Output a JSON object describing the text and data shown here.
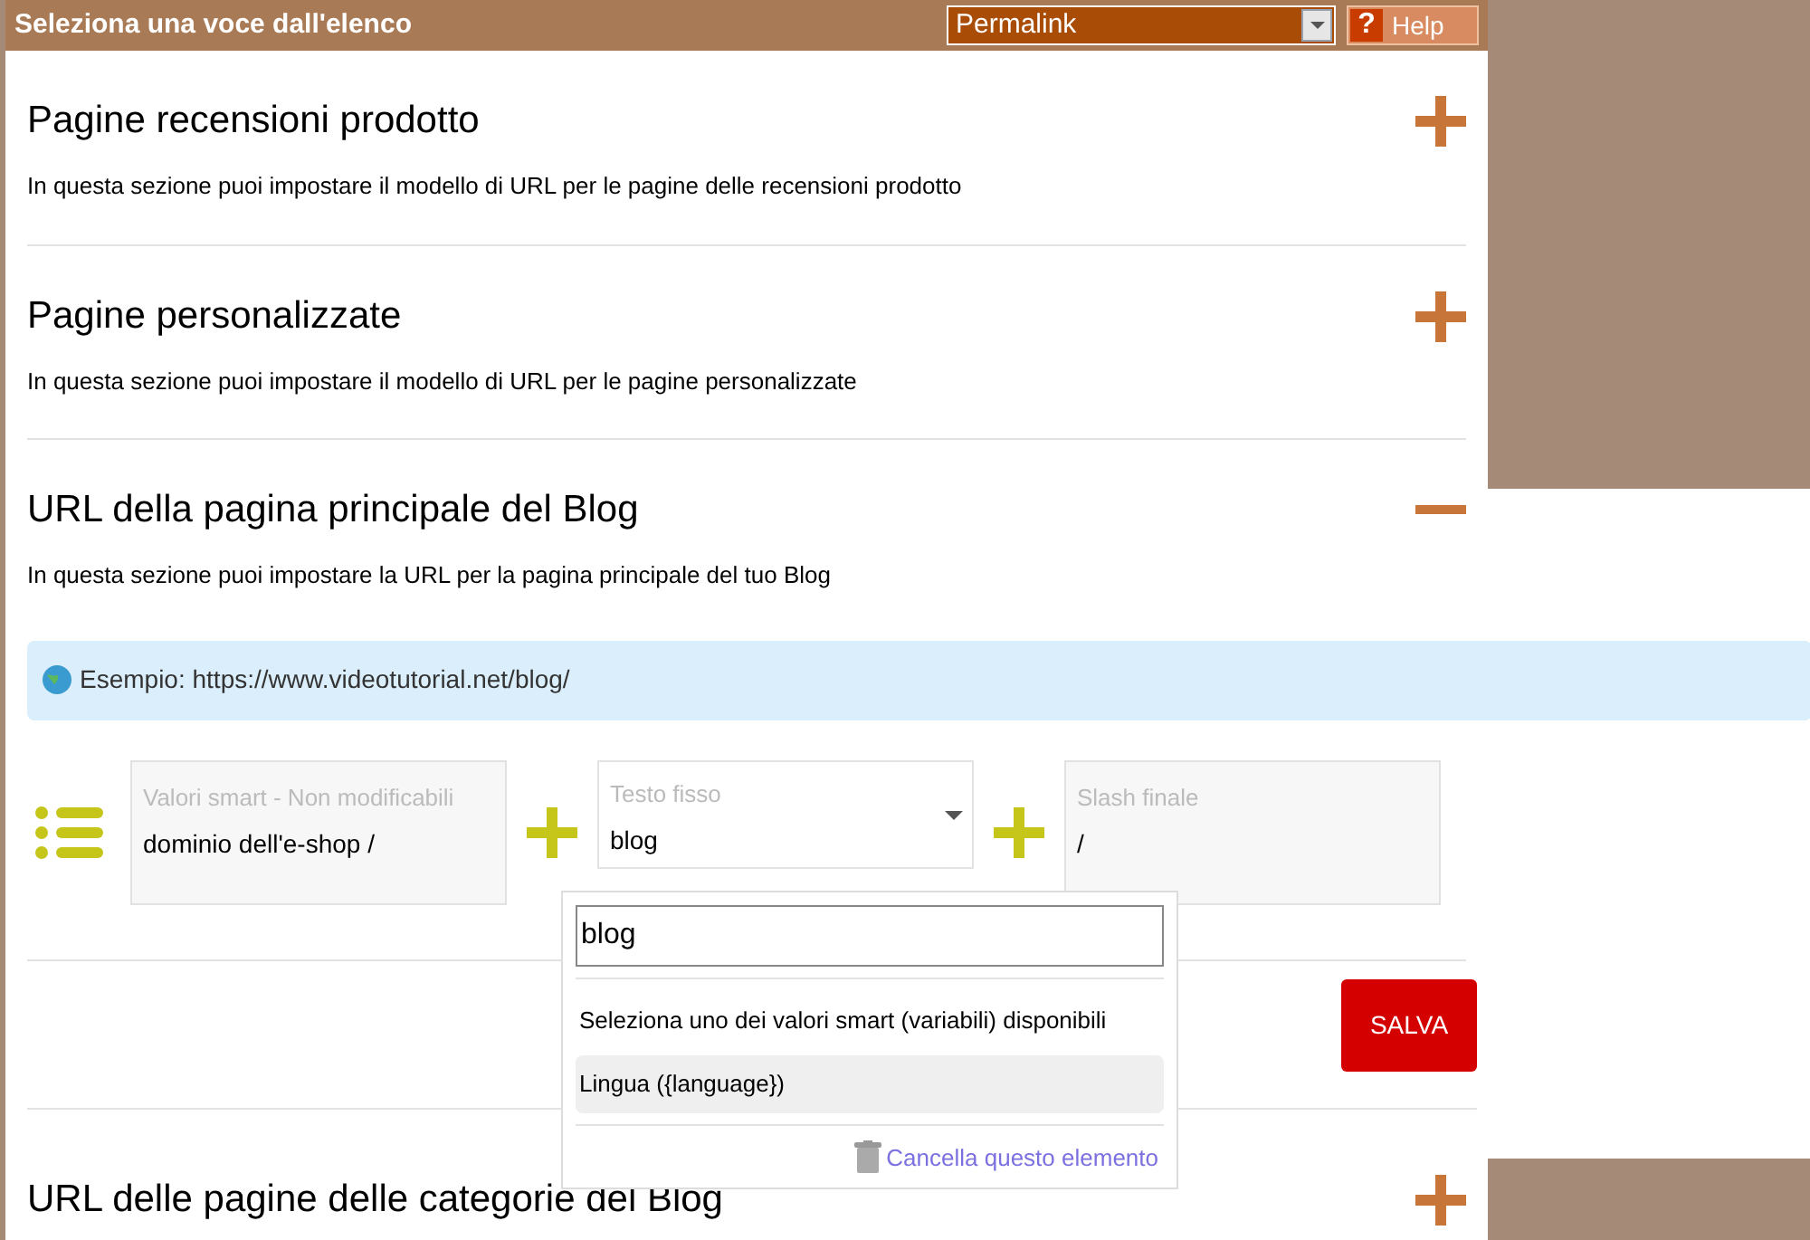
{
  "header": {
    "title": "Seleziona una voce dall'elenco",
    "select": {
      "value": "Permalink"
    },
    "help_button": {
      "label": "Help",
      "icon_text": "?"
    }
  },
  "sections": [
    {
      "title": "Pagine recensioni prodotto",
      "expanded": false,
      "description": "In questa sezione puoi impostare il modello di URL per le pagine delle recensioni prodotto"
    },
    {
      "title": "Pagine personalizzate",
      "expanded": false,
      "description": "In questa sezione puoi impostare il modello di URL per le pagine personalizzate"
    },
    {
      "title": "URL della pagina principale del Blog",
      "expanded": true,
      "description": "In questa sezione puoi impostare la URL per la pagina principale del tuo Blog",
      "example": "Esempio: https://www.videotutorial.net/blog/",
      "fields": [
        {
          "kind": "fixed",
          "label": "Valori smart - Non modificabili",
          "value": "dominio dell'e-shop /"
        },
        {
          "kind": "dropdown",
          "label": "Testo fisso",
          "value": "blog"
        },
        {
          "kind": "fixed",
          "label": "Slash finale",
          "value": "/"
        }
      ],
      "save_button": "SALVA",
      "popup": {
        "input_value": "blog",
        "hint": "Seleziona uno dei valori smart (variabili) disponibili",
        "options": [
          {
            "label": "Lingua ({language})",
            "selected": true
          }
        ],
        "delete_link": "Cancella questo elemento"
      }
    },
    {
      "title": "URL delle pagine delle categorie del Blog",
      "expanded": false
    }
  ]
}
